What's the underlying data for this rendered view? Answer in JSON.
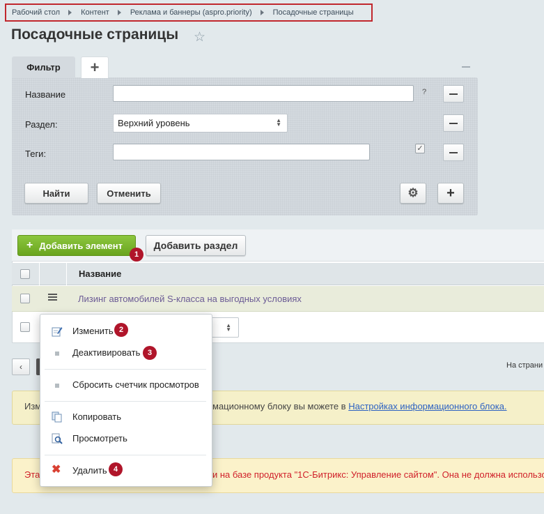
{
  "breadcrumb": [
    "Рабочий стол",
    "Контент",
    "Реклама и баннеры (aspro.priority)",
    "Посадочные страницы"
  ],
  "page": {
    "title": "Посадочные страницы"
  },
  "filter": {
    "tab_label": "Фильтр",
    "fields": {
      "name_label": "Название",
      "section_label": "Раздел:",
      "section_value": "Верхний уровень",
      "tags_label": "Теги:",
      "help": "?"
    },
    "find_label": "Найти",
    "cancel_label": "Отменить"
  },
  "toolbar": {
    "add_element": "Добавить элемент",
    "add_section": "Добавить раздел"
  },
  "table": {
    "columns": [
      "Название"
    ],
    "rows": [
      {
        "name": "Лизинг автомобилей S-класса на выгодных условиях"
      }
    ]
  },
  "context_menu": {
    "items": [
      {
        "label": "Изменить",
        "icon": "edit-icon",
        "badge": "2"
      },
      {
        "label": "Деактивировать",
        "icon": "dot-icon",
        "badge": "3"
      },
      {
        "label": "Сбросить счетчик просмотров",
        "icon": "dot-icon"
      },
      {
        "label": "Копировать",
        "icon": "copy-icon"
      },
      {
        "label": "Просмотреть",
        "icon": "view-icon"
      },
      {
        "label": "Удалить",
        "icon": "delete-icon",
        "badge": "4"
      }
    ]
  },
  "badges": {
    "add_element": "1"
  },
  "pagination": {
    "right_text": "На страни"
  },
  "notices": {
    "info_prefix": "Изм",
    "info_text": "мационному блоку вы можете в ",
    "info_link": "Настройках информационного блока.",
    "warning_prefix": "Эта",
    "warning_text": "и на базе продукта \"1С-Битрикс: Управление сайтом\". Она не должна использо"
  },
  "colors": {
    "accent_green": "#7ab52f",
    "badge_red": "#b0152a",
    "link": "#2c61c2",
    "warning_red": "#d0202a"
  }
}
